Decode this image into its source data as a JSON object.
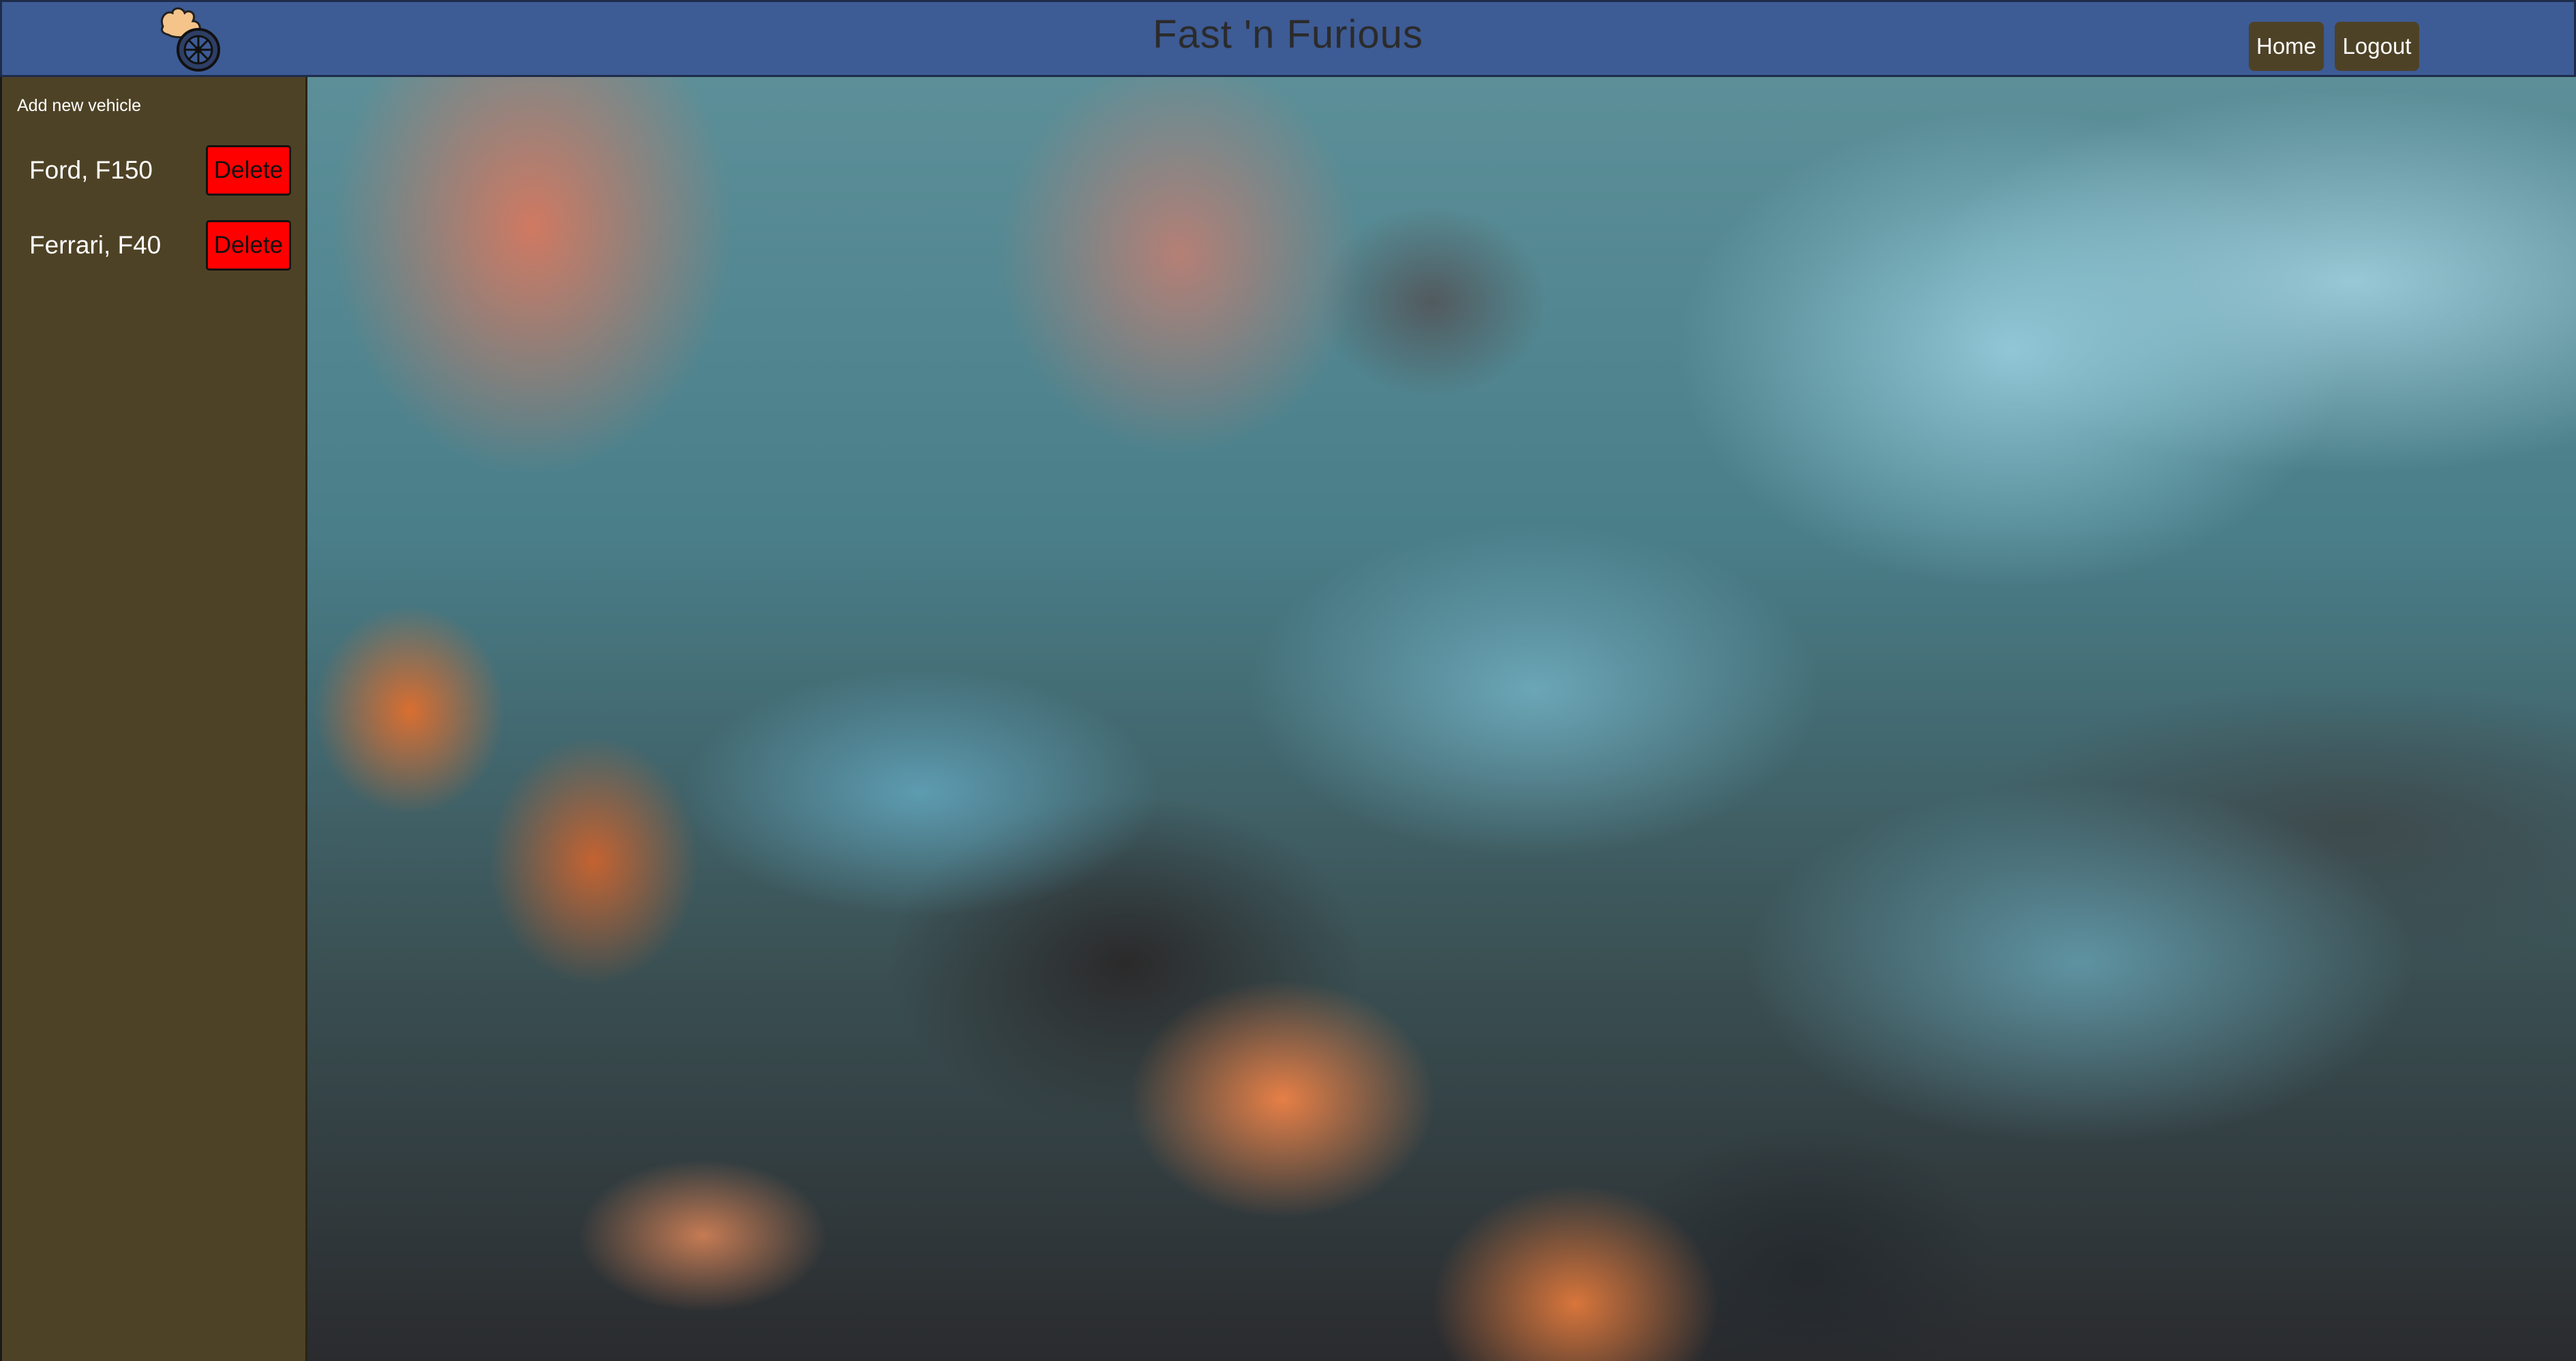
{
  "header": {
    "title": "Fast 'n Furious",
    "logo_icon": "flaming-wheel-logo-icon",
    "nav": {
      "home_label": "Home",
      "logout_label": "Logout"
    }
  },
  "sidebar": {
    "add_label": "Add new vehicle",
    "vehicles": [
      {
        "name": "Ford, F150",
        "delete_label": "Delete"
      },
      {
        "name": "Ferrari, F40",
        "delete_label": "Delete"
      }
    ]
  },
  "colors": {
    "header_bg": "#3d5b95",
    "sidebar_bg": "#4e4226",
    "delete_bg": "#ff0000",
    "nav_button_bg": "#4e4226"
  }
}
